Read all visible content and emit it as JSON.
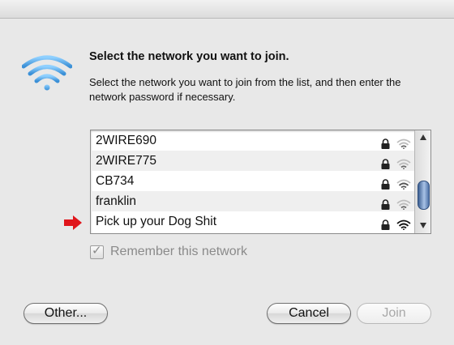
{
  "dialog": {
    "heading": "Select the network you want to join.",
    "description": "Select the network you want to join from the list, and then enter the network password if necessary."
  },
  "networks": [
    {
      "name": "2WIRE690",
      "secured": true,
      "signal": "weak"
    },
    {
      "name": "2WIRE775",
      "secured": true,
      "signal": "weak"
    },
    {
      "name": "CB734",
      "secured": true,
      "signal": "medium"
    },
    {
      "name": "franklin",
      "secured": true,
      "signal": "weak"
    },
    {
      "name": "Pick up your Dog Shit",
      "secured": true,
      "signal": "strong"
    }
  ],
  "remember": {
    "label": "Remember this network",
    "checked": true,
    "enabled": false
  },
  "buttons": {
    "other": "Other...",
    "cancel": "Cancel",
    "join": "Join"
  },
  "icons": {
    "wifi": "wifi-icon",
    "lock": "lock-icon",
    "pointer": "red-arrow-icon"
  },
  "colors": {
    "wifi_blue": "#5aa9e6",
    "arrow_red": "#e0151b"
  }
}
